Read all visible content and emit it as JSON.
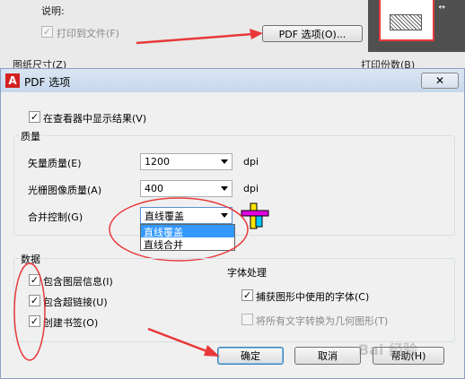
{
  "background_dialog": {
    "description_label": "说明:",
    "print_to_file_label": "打印到文件(F)",
    "pdf_options_button": "PDF 选项(O)...",
    "paper_size_label": "图纸尺寸(Z)",
    "print_copies_label": "打印份数(B)"
  },
  "dialog": {
    "title": "PDF 选项",
    "close_label": "✕",
    "show_in_viewer_label": "在查看器中显示结果(V)",
    "quality_group_label": "质量",
    "vector_quality_label": "矢量质量(E)",
    "vector_quality_value": "1200",
    "raster_quality_label": "光栅图像质量(A)",
    "raster_quality_value": "400",
    "dpi_unit": "dpi",
    "merge_control_label": "合并控制(G)",
    "merge_control_value": "直线覆盖",
    "merge_options": [
      "直线覆盖",
      "直线合并"
    ],
    "data_group_label": "数据",
    "include_layers_label": "包含图层信息(I)",
    "include_hyperlinks_label": "包含超链接(U)",
    "create_bookmarks_label": "创建书签(O)",
    "font_group_label": "字体处理",
    "capture_fonts_label": "捕获图形中使用的字体(C)",
    "convert_text_label": "将所有文字转换为几何图形(T)",
    "ok_label": "确定",
    "cancel_label": "取消",
    "help_label": "帮助(H)"
  },
  "colors": {
    "annotation_red": "#e8383a",
    "selection_blue": "#3399ff"
  },
  "watermark": "Bai 经验"
}
